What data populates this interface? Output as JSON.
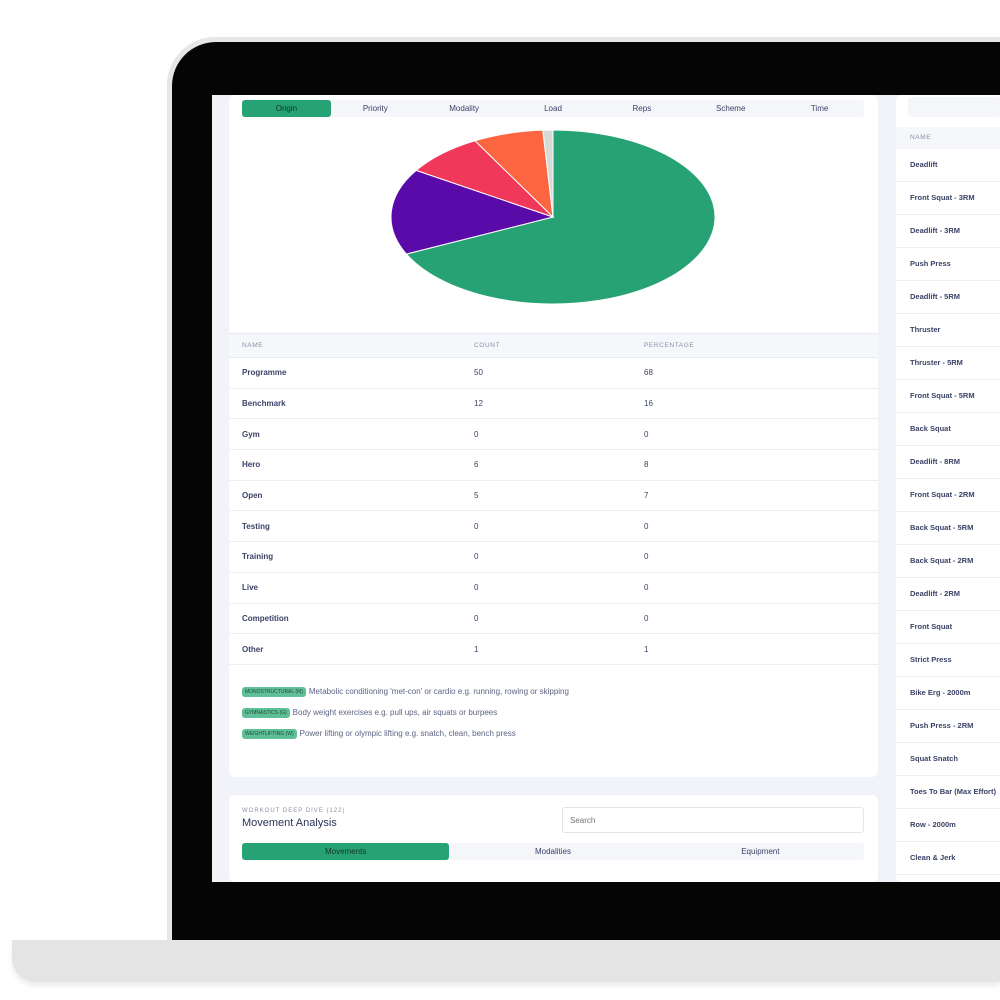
{
  "origin_tabs": [
    "Origin",
    "Priority",
    "Modality",
    "Load",
    "Reps",
    "Scheme",
    "Time"
  ],
  "active_tab": "Origin",
  "colors": {
    "accent": "#26a275",
    "programme": "#26a275",
    "benchmark": "#5a0aa8",
    "hero": "#f0385a",
    "open": "#fb6640",
    "other": "#d8dad8"
  },
  "chart_data": {
    "type": "pie",
    "start": "top",
    "direction": "clockwise",
    "slices": [
      {
        "label": "Programme",
        "value": 68,
        "color": "#26a275"
      },
      {
        "label": "Benchmark",
        "value": 16,
        "color": "#5a0aa8"
      },
      {
        "label": "Hero",
        "value": 8,
        "color": "#f0385a"
      },
      {
        "label": "Open",
        "value": 7,
        "color": "#fb6640"
      },
      {
        "label": "Other",
        "value": 1,
        "color": "#d8dad8"
      }
    ]
  },
  "table": {
    "headers": [
      "NAME",
      "COUNT",
      "PERCENTAGE"
    ],
    "rows": [
      [
        "Programme",
        "50",
        "68"
      ],
      [
        "Benchmark",
        "12",
        "16"
      ],
      [
        "Gym",
        "0",
        "0"
      ],
      [
        "Hero",
        "6",
        "8"
      ],
      [
        "Open",
        "5",
        "7"
      ],
      [
        "Testing",
        "0",
        "0"
      ],
      [
        "Training",
        "0",
        "0"
      ],
      [
        "Live",
        "0",
        "0"
      ],
      [
        "Competition",
        "0",
        "0"
      ],
      [
        "Other",
        "1",
        "1"
      ]
    ]
  },
  "legend": [
    {
      "badge": "Monostructural (M)",
      "text": "Metabolic conditioning 'met-con' or cardio e.g. running, rowing or skipping"
    },
    {
      "badge": "Gymnastics (G)",
      "text": "Body weight exercises e.g. pull ups, air squats or burpees"
    },
    {
      "badge": "Weightlifting (W)",
      "text": "Power lifting or olympic lifting e.g. snatch, clean, bench press"
    }
  ],
  "movement": {
    "eyebrow": "WORKOUT DEEP DIVE (122)",
    "title": "Movement Analysis",
    "search_placeholder": "Search",
    "tabs": [
      "Movements",
      "Modalities",
      "Equipment"
    ]
  },
  "right_list": {
    "header": "NAME",
    "items": [
      "Deadlift",
      "Front Squat - 3RM",
      "Deadlift - 3RM",
      "Push Press",
      "Deadlift - 5RM",
      "Thruster",
      "Thruster - 5RM",
      "Front Squat - 5RM",
      "Back Squat",
      "Deadlift - 8RM",
      "Front Squat - 2RM",
      "Back Squat - 5RM",
      "Back Squat - 2RM",
      "Deadlift - 2RM",
      "Front Squat",
      "Strict Press",
      "Bike Erg - 2000m",
      "Push Press - 2RM",
      "Squat Snatch",
      "Toes To Bar (Max Effort)",
      "Row - 2000m",
      "Clean & Jerk"
    ]
  }
}
